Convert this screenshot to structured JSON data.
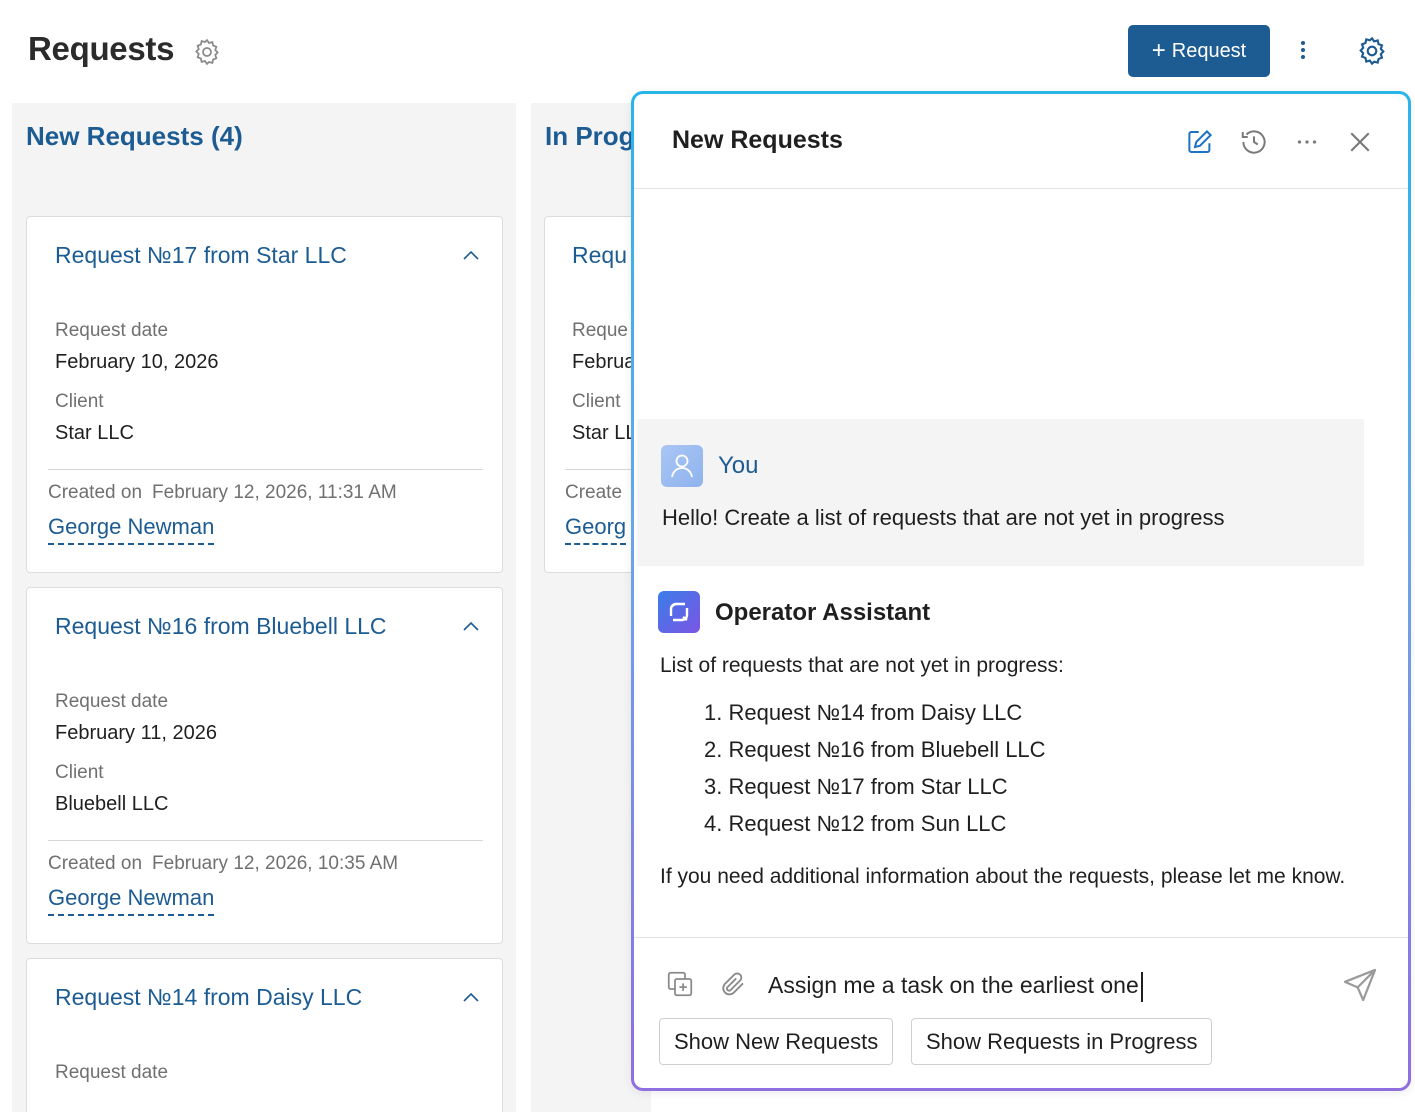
{
  "header": {
    "title": "Requests",
    "new_button_label": "Request",
    "new_button_icon": "plus-icon",
    "menu_icon": "kebab-icon",
    "settings_icon": "gear-icon"
  },
  "columns": [
    {
      "title": "New Requests (4)",
      "cards": [
        {
          "title": "Request №17 from Star LLC",
          "date_label": "Request date",
          "date": "February 10, 2026",
          "client_label": "Client",
          "client": "Star LLC",
          "created_label": "Created on",
          "created": "February 12, 2026, 11:31 AM",
          "author": "George Newman"
        },
        {
          "title": "Request №16 from Bluebell LLC",
          "date_label": "Request date",
          "date": "February 11, 2026",
          "client_label": "Client",
          "client": "Bluebell LLC",
          "created_label": "Created on",
          "created": "February 12, 2026, 10:35 AM",
          "author": "George Newman"
        },
        {
          "title": "Request №14 from Daisy LLC",
          "date_label": "Request date"
        }
      ]
    },
    {
      "title": "In Progr",
      "cards": [
        {
          "title": "Requ",
          "date_label": "Reque",
          "date": "Februa",
          "client_label": "Client",
          "client": "Star LL",
          "created_label": "Create",
          "author": "Georg"
        }
      ]
    }
  ],
  "chat": {
    "title": "New Requests",
    "icons": [
      "edit-icon",
      "history-icon",
      "more-icon",
      "close-icon"
    ],
    "user": {
      "name": "You",
      "message": "Hello! Create a list of requests that are not yet in progress"
    },
    "assistant": {
      "name": "Operator Assistant",
      "intro": "List of requests that are not yet in progress:",
      "items": [
        "1. Request №14 from Daisy LLC",
        "2. Request №16 from Bluebell LLC",
        "3. Request №17 from Star LLC",
        "4. Request №12 from Sun LLC"
      ],
      "outro": "If you need additional information about the requests, please let me know."
    },
    "input_value": "Assign me a task on the earliest one",
    "suggestions": [
      "Show New Requests",
      "Show Requests in Progress"
    ]
  },
  "colors": {
    "primary": "#1d5c93",
    "column_bg": "#f4f4f5",
    "chat_border_top": "#29b5e8",
    "chat_border_bottom": "#8f6ee0"
  }
}
